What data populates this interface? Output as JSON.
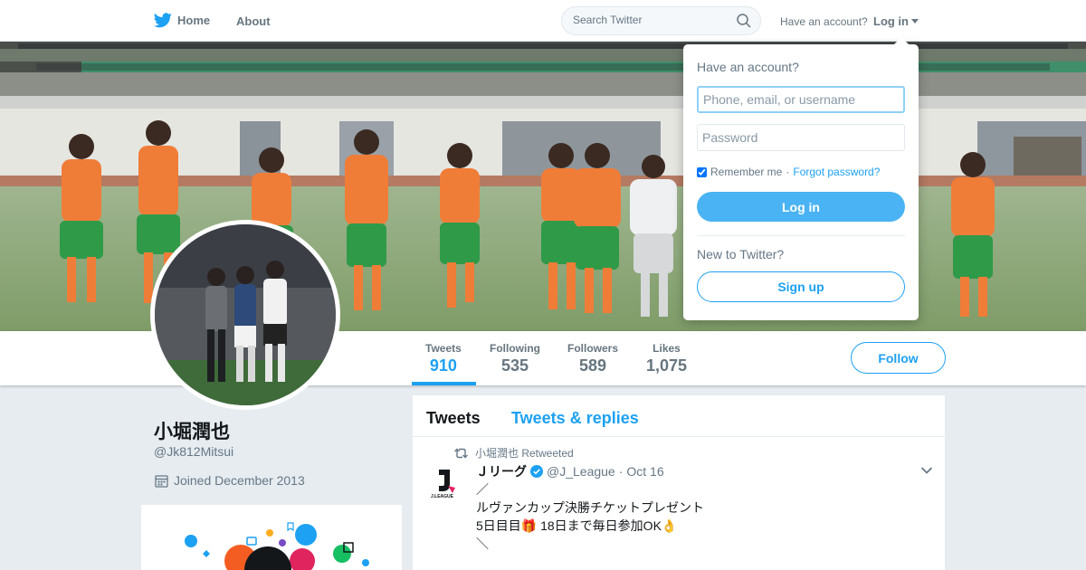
{
  "nav": {
    "home_label": "Home",
    "about_label": "About",
    "search_placeholder": "Search Twitter",
    "account_question": "Have an account?",
    "login_label": "Log in"
  },
  "profile": {
    "name": "小堀潤也",
    "handle": "@Jk812Mitsui",
    "joined": "Joined December 2013",
    "follow_label": "Follow"
  },
  "stats": [
    {
      "label": "Tweets",
      "value": "910"
    },
    {
      "label": "Following",
      "value": "535"
    },
    {
      "label": "Followers",
      "value": "589"
    },
    {
      "label": "Likes",
      "value": "1,075"
    }
  ],
  "timeline": {
    "tabs": [
      "Tweets",
      "Tweets & replies"
    ],
    "tweet": {
      "retweet_context": "小堀潤也 Retweeted",
      "author_name": "Ｊリーグ",
      "author_handle": "@J_League",
      "separator": "·",
      "time": "Oct 16",
      "lines": [
        "／",
        "ルヴァンカップ決勝チケットプレゼント",
        "5日目目🎁 18日まで毎日参加OK👌",
        "＼"
      ]
    }
  },
  "login_dropdown": {
    "title": "Have an account?",
    "username_placeholder": "Phone, email, or username",
    "password_placeholder": "Password",
    "remember_label": "Remember me",
    "separator": "·",
    "forgot_label": "Forgot password?",
    "login_button": "Log in",
    "new_label": "New to Twitter?",
    "signup_button": "Sign up"
  },
  "colors": {
    "accent": "#1da1f2",
    "background": "#e6ecf0",
    "muted_text": "#657786"
  }
}
